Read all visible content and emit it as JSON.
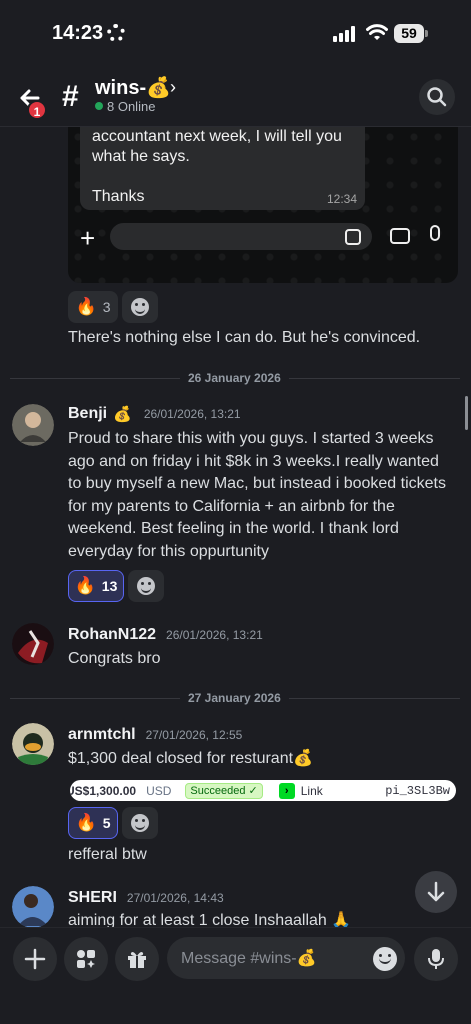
{
  "status_bar": {
    "time": "14:23",
    "battery": "59"
  },
  "header": {
    "channel_name": "wins-💰",
    "online": "8 Online",
    "unread_badge": "1"
  },
  "embed_image": {
    "lines": [
      "accountant next week, I will tell you",
      "what he says.",
      "",
      "Thanks"
    ],
    "time": "12:34"
  },
  "continued_message": {
    "reactions": [
      {
        "emoji": "🔥",
        "count": "3",
        "active": false
      }
    ],
    "text": "There's nothing else I can do. But he's convinced."
  },
  "date_dividers": [
    "26 January 2026",
    "27 January 2026"
  ],
  "messages": [
    {
      "username": "Benji",
      "badge": "💰",
      "timestamp": "26/01/2026, 13:21",
      "lines": [
        "Proud to share this with you guys. I started 3 weeks",
        "ago and on friday i hit $8k in 3 weeks.I really wanted",
        "to buy myself a new Mac, but instead i booked tickets",
        "for my parents to California + an airbnb for the",
        "weekend. Best feeling in the world. I thank lord",
        "everyday for this oppurtunity"
      ],
      "reactions": [
        {
          "emoji": "🔥",
          "count": "13",
          "active": true
        }
      ]
    },
    {
      "username": "RohanN122",
      "timestamp": "26/01/2026, 13:21",
      "lines": [
        "Congrats bro"
      ]
    },
    {
      "username": "arnmtchl",
      "timestamp": "27/01/2026, 12:55",
      "lines": [
        "$1,300 deal closed for resturant💰"
      ],
      "payment": {
        "amount": "US$1,300.00",
        "currency": "USD",
        "status": "Succeeded ✓",
        "link": "Link",
        "id": "pi_3SL3Bw"
      },
      "reactions": [
        {
          "emoji": "🔥",
          "count": "5",
          "active": true
        }
      ],
      "followup": "refferal btw"
    },
    {
      "username": "SHERI",
      "timestamp": "27/01/2026, 14:43",
      "lines": [
        "aiming for at least 1 close Inshaallah 🙏"
      ]
    }
  ],
  "composer": {
    "placeholder": "Message #wins-💰"
  }
}
